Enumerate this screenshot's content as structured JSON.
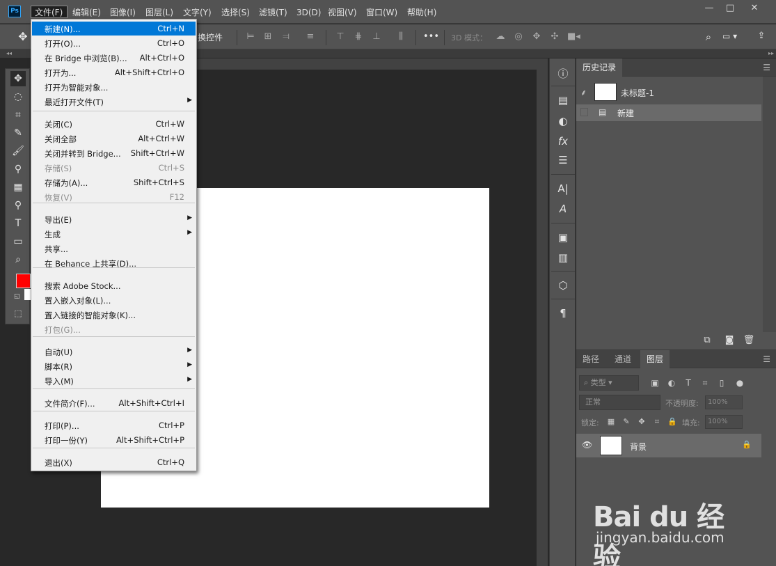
{
  "app": {
    "logo_text": "Ps"
  },
  "menubar": {
    "items": [
      "文件(F)",
      "编辑(E)",
      "图像(I)",
      "图层(L)",
      "文字(Y)",
      "选择(S)",
      "滤镜(T)",
      "3D(D)",
      "视图(V)",
      "窗口(W)",
      "帮助(H)"
    ],
    "window_controls": {
      "minimize": "—",
      "maximize": "□",
      "close": "✕"
    }
  },
  "optionsbar": {
    "transform_controls_label": "换控件",
    "mode_3d_label": "3D 模式：",
    "more_label": "•••"
  },
  "file_menu": {
    "items": [
      {
        "label": "新建(N)...",
        "shortcut": "Ctrl+N",
        "highlighted": true
      },
      {
        "label": "打开(O)...",
        "shortcut": "Ctrl+O"
      },
      {
        "label": "在 Bridge 中浏览(B)...",
        "shortcut": "Alt+Ctrl+O"
      },
      {
        "label": "打开为...",
        "shortcut": "Alt+Shift+Ctrl+O"
      },
      {
        "label": "打开为智能对象...",
        "shortcut": ""
      },
      {
        "label": "最近打开文件(T)",
        "shortcut": "",
        "submenu": true
      },
      {
        "label": "关闭(C)",
        "shortcut": "Ctrl+W"
      },
      {
        "label": "关闭全部",
        "shortcut": "Alt+Ctrl+W"
      },
      {
        "label": "关闭并转到 Bridge...",
        "shortcut": "Shift+Ctrl+W"
      },
      {
        "label": "存储(S)",
        "shortcut": "Ctrl+S",
        "disabled": true
      },
      {
        "label": "存储为(A)...",
        "shortcut": "Shift+Ctrl+S"
      },
      {
        "label": "恢复(V)",
        "shortcut": "F12",
        "disabled": true
      },
      {
        "label": "导出(E)",
        "shortcut": "",
        "submenu": true
      },
      {
        "label": "生成",
        "shortcut": "",
        "submenu": true
      },
      {
        "label": "共享...",
        "shortcut": ""
      },
      {
        "label": "在 Behance 上共享(D)...",
        "shortcut": ""
      },
      {
        "label": "搜索 Adobe Stock...",
        "shortcut": ""
      },
      {
        "label": "置入嵌入对象(L)...",
        "shortcut": ""
      },
      {
        "label": "置入链接的智能对象(K)...",
        "shortcut": ""
      },
      {
        "label": "打包(G)...",
        "shortcut": "",
        "disabled": true
      },
      {
        "label": "自动(U)",
        "shortcut": "",
        "submenu": true
      },
      {
        "label": "脚本(R)",
        "shortcut": "",
        "submenu": true
      },
      {
        "label": "导入(M)",
        "shortcut": "",
        "submenu": true
      },
      {
        "label": "文件简介(F)...",
        "shortcut": "Alt+Shift+Ctrl+I"
      },
      {
        "label": "打印(P)...",
        "shortcut": "Ctrl+P"
      },
      {
        "label": "打印一份(Y)",
        "shortcut": "Alt+Shift+Ctrl+P"
      },
      {
        "label": "退出(X)",
        "shortcut": "Ctrl+Q"
      }
    ]
  },
  "toolbar": {
    "foreground_color": "#ff0000",
    "background_color": "#ffffff"
  },
  "history_panel": {
    "tab_label": "历史记录",
    "snapshot_label": "未标题-1",
    "step_label": "新建"
  },
  "layers_panel": {
    "tabs": [
      "路径",
      "通道",
      "图层"
    ],
    "active_tab": "图层",
    "filter_label": "类型",
    "blend_mode": "正常",
    "opacity_label": "不透明度:",
    "opacity_value": "100%",
    "lock_label": "锁定:",
    "fill_label": "填充:",
    "fill_value": "100%",
    "layer_name": "背景"
  },
  "watermark": {
    "logo": "Bai du 经验",
    "url": "jingyan.baidu.com"
  }
}
